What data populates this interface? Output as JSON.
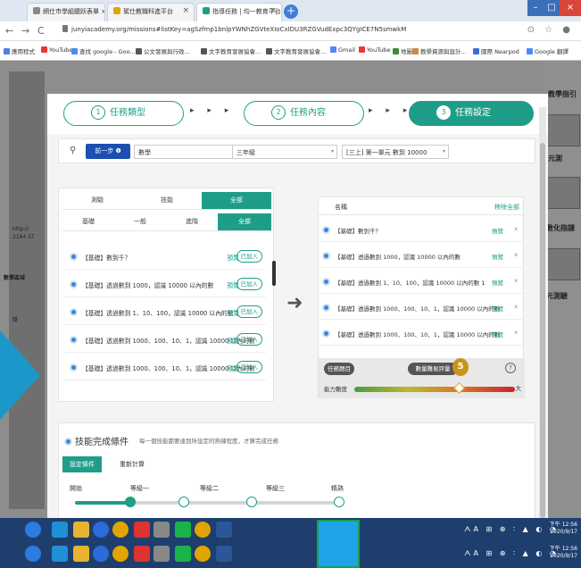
{
  "browser": {
    "tabs": [
      {
        "label": "網仕市學組臘跃表單 ×"
      },
      {
        "label": "駕仕教職科進平台"
      },
      {
        "label": "指導任務 | 均一教育平台"
      }
    ],
    "url": "junyiacademy.org/missions#listKey=agSzfmp1bnlpYWNhZGVteXIoCxIDU3RZGVudExpc3QYgICE7N5smwkM",
    "address_icons": "⊙ ☆ ●",
    "bookmarks": [
      "應用程式",
      "YouTube",
      "查找 google - Goo...",
      "公文發展與行政...",
      "文字教育發展協會...",
      "文字教育發展協會...",
      "Gmail",
      "YouTube",
      "地圖",
      "教學資源與設計...",
      "國際 Nearpod",
      "Google 翻譯"
    ]
  },
  "background": {
    "right_title": "教學指引",
    "right_labels": [
      "元測",
      "數化指課",
      "元測驗"
    ],
    "left_labels": [
      "http://",
      "2184 ST",
      "數學區域",
      "獎"
    ]
  },
  "steps": [
    {
      "num": "1",
      "label": "任務類型"
    },
    {
      "num": "2",
      "label": "任務內容"
    },
    {
      "num": "3",
      "label": "任務設定"
    }
  ],
  "filter": {
    "search_icon": "search-icon",
    "prev_button": "前一步 ❶",
    "subject": "數學",
    "grade": "三年級",
    "unit": "[三上] 第一單元 數到 10000"
  },
  "left_panel": {
    "tabs_row1": [
      "測驗",
      "技能",
      "全部"
    ],
    "tabs_row2": [
      "基礎",
      "一般",
      "進階",
      "全部"
    ],
    "items": [
      {
        "text": "【基礎】數到千？",
        "link": "預覽",
        "badge": "已加入"
      },
      {
        "text": "【基礎】透過數到 1000，認識 10000 以內的數",
        "link": "預覽",
        "badge": "已加入"
      },
      {
        "text": "【基礎】透過數到 1、10、100，認識 10000 以內的數 1",
        "link": "預覽",
        "badge": "已加入"
      },
      {
        "text": "【基礎】透過數到 1000、100、10、1，認識 10000 以內的數",
        "link": "預覽",
        "badge": "已加入"
      },
      {
        "text": "【基礎】透過數到 1000、100、10、1，認識 10000 以內的數",
        "link": "預覽",
        "badge": "已加入"
      }
    ]
  },
  "right_panel": {
    "col_name": "名稱",
    "col_action": "移除全部",
    "items": [
      {
        "text": "【基礎】數到千？",
        "link": "預覽"
      },
      {
        "text": "【基礎】透過數到 1000，認識 10000 以內的數",
        "link": "預覽"
      },
      {
        "text": "【基礎】透過數到 1、10、100，認識 10000 以內的數 1",
        "link": "預覽"
      },
      {
        "text": "【基礎】透過數到 1000、100、10、1，認識 10000 以內的數",
        "link": "預覽"
      },
      {
        "text": "【基礎】透過數到 1000、100、10、1，認識 10000 以內的數",
        "link": "預覽"
      }
    ],
    "remove_glyph": "x",
    "footer": {
      "count_label": "任務題目",
      "count_label2": "數量難易評量",
      "count_value": "5",
      "help": "?",
      "difficulty_label": "能力難度",
      "difficulty_left": "小",
      "difficulty_right": "大",
      "difficulty_level": 0.78
    }
  },
  "completion": {
    "title": "技能完成條件",
    "desc": "每一個技能都要達到所設定的熟練程度，才算完成任務",
    "tabs": [
      "設定條件",
      "重新計算"
    ],
    "levels": [
      "開始",
      "等級一",
      "等級二",
      "等級三",
      "精熟"
    ],
    "selected_level": "等級一"
  },
  "taskbar": {
    "clock_time": "下午 12:56",
    "clock_date": "2020/9/17",
    "tray": "ᗅA ⊞ ⊕ ∶ ▲ ◐ ◔"
  },
  "colors": {
    "accent": "#1e9e88",
    "primary_button": "#1d4fb0",
    "coin": "#c8941a"
  }
}
